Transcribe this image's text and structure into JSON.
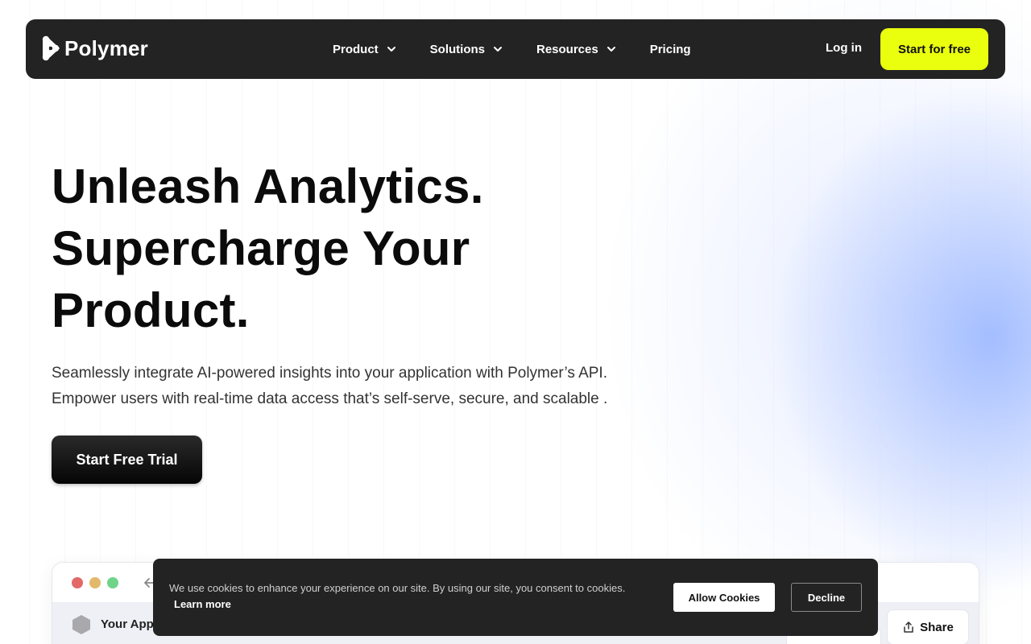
{
  "brand": {
    "name": "Polymer"
  },
  "nav": {
    "items": [
      {
        "label": "Product",
        "has_dropdown": true
      },
      {
        "label": "Solutions",
        "has_dropdown": true
      },
      {
        "label": "Resources",
        "has_dropdown": true
      },
      {
        "label": "Pricing",
        "has_dropdown": false
      }
    ],
    "login_label": "Log in",
    "cta_label": "Start for free"
  },
  "hero": {
    "title_lines": [
      "Unleash Analytics.",
      "Supercharge Your",
      "Product."
    ],
    "subtitle_lines": [
      "Seamlessly integrate AI-powered insights into your application with Polymer’s API.",
      "Empower users with real-time data access that’s self-serve, secure, and scalable ."
    ],
    "cta_label": "Start Free Trial"
  },
  "preview": {
    "app_name": "Your App",
    "share_label": "Share"
  },
  "cookie_banner": {
    "message": "We use cookies to enhance your experience on our site. By using our site, you consent to cookies.",
    "learn_more_label": "Learn more",
    "allow_label": "Allow Cookies",
    "decline_label": "Decline"
  },
  "colors": {
    "nav_bg": "#232323",
    "cta_yellow": "#eaff0e",
    "window_red": "#e36868",
    "window_yellow": "#e2b86a",
    "window_green": "#6fd48a",
    "glow_blue": "#96b4ff"
  }
}
